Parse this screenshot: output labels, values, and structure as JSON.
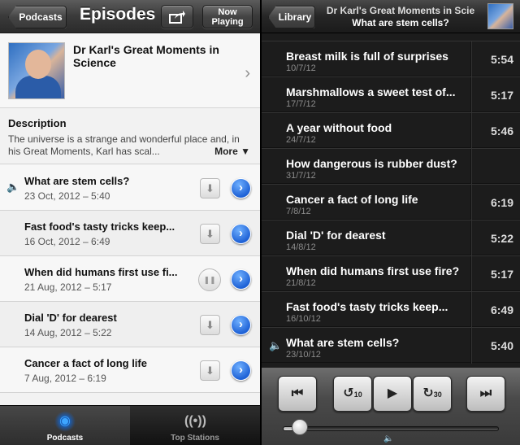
{
  "left": {
    "nav": {
      "back_label": "Podcasts",
      "title": "Episodes",
      "share_icon": "share-icon",
      "now_playing_line1": "Now",
      "now_playing_line2": "Playing"
    },
    "podcast": {
      "title": "Dr Karl's Great Moments in Science"
    },
    "description": {
      "heading": "Description",
      "text": "The universe is a strange and wonderful place and, in his Great Moments, Karl has scal...",
      "more_label": "More ▼"
    },
    "episodes": [
      {
        "title": "What are stem cells?",
        "date": "23 Oct, 2012 – 5:40",
        "playing": true,
        "action": "download"
      },
      {
        "title": "Fast food's tasty tricks keep...",
        "date": "16 Oct, 2012 – 6:49",
        "playing": false,
        "action": "download"
      },
      {
        "title": "When did humans first use fi...",
        "date": "21 Aug, 2012 – 5:17",
        "playing": false,
        "action": "pause"
      },
      {
        "title": "Dial 'D' for dearest",
        "date": "14 Aug, 2012 – 5:22",
        "playing": false,
        "action": "download"
      },
      {
        "title": "Cancer a fact of long life",
        "date": "7 Aug, 2012 – 6:19",
        "playing": false,
        "action": "download"
      }
    ],
    "tabs": [
      {
        "label": "Podcasts",
        "active": true
      },
      {
        "label": "Top Stations",
        "active": false
      }
    ]
  },
  "right": {
    "nav": {
      "back_label": "Library",
      "title": "Dr Karl's Great Moments in Scie",
      "subtitle": "What are stem cells?"
    },
    "episodes": [
      {
        "title": "Breast milk is full of surprises",
        "date": "10/7/12",
        "duration": "5:54",
        "playing": false
      },
      {
        "title": "Marshmallows a sweet test of...",
        "date": "17/7/12",
        "duration": "5:17",
        "playing": false
      },
      {
        "title": "A year without food",
        "date": "24/7/12",
        "duration": "5:46",
        "playing": false
      },
      {
        "title": "How dangerous is rubber dust?",
        "date": "31/7/12",
        "duration": "",
        "playing": false
      },
      {
        "title": "Cancer a fact of long life",
        "date": "7/8/12",
        "duration": "6:19",
        "playing": false
      },
      {
        "title": "Dial 'D' for dearest",
        "date": "14/8/12",
        "duration": "5:22",
        "playing": false
      },
      {
        "title": "When did humans first use fire?",
        "date": "21/8/12",
        "duration": "5:17",
        "playing": false
      },
      {
        "title": "Fast food's tasty tricks keep...",
        "date": "16/10/12",
        "duration": "6:49",
        "playing": false
      },
      {
        "title": "What are stem cells?",
        "date": "23/10/12",
        "duration": "5:40",
        "playing": true
      }
    ],
    "controls": {
      "skip_back_icon": "previous-track-icon",
      "rewind_label": "10",
      "play_icon": "play-icon",
      "forward_label": "30",
      "skip_forward_icon": "next-track-icon",
      "volume_level": 0.08
    }
  }
}
